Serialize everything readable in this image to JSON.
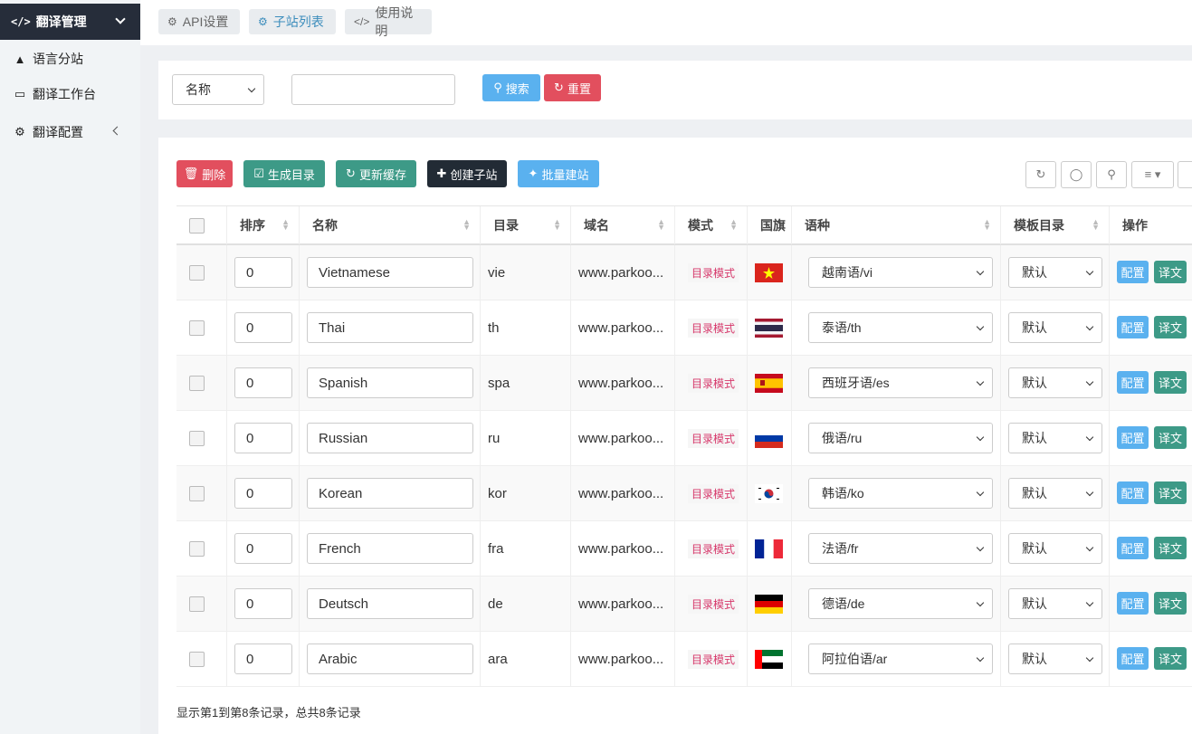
{
  "sidebar": {
    "header": "翻译管理",
    "items": [
      {
        "label": "语言分站"
      },
      {
        "label": "翻译工作台"
      },
      {
        "label": "翻译配置"
      }
    ]
  },
  "tabs": [
    {
      "label": "API设置"
    },
    {
      "label": "子站列表"
    },
    {
      "label": "使用说明"
    }
  ],
  "search": {
    "field_select": "名称",
    "keyword": "",
    "search_label": "搜索",
    "reset_label": "重置"
  },
  "toolbar": {
    "delete": "删除",
    "gen_dir": "生成目录",
    "refresh_cache": "更新缓存",
    "create_site": "创建子站",
    "batch_create": "批量建站"
  },
  "columns": [
    "排序",
    "名称",
    "目录",
    "域名",
    "模式",
    "国旗",
    "语种",
    "模板目录",
    "操作"
  ],
  "rows": [
    {
      "sort": "0",
      "name": "Vietnamese",
      "dir": "vie",
      "domain": "www.parkoo...",
      "mode": "目录模式",
      "flag": "vn",
      "lang": "越南语/vi",
      "tpl": "默认"
    },
    {
      "sort": "0",
      "name": "Thai",
      "dir": "th",
      "domain": "www.parkoo...",
      "mode": "目录模式",
      "flag": "th",
      "lang": "泰语/th",
      "tpl": "默认"
    },
    {
      "sort": "0",
      "name": "Spanish",
      "dir": "spa",
      "domain": "www.parkoo...",
      "mode": "目录模式",
      "flag": "es",
      "lang": "西班牙语/es",
      "tpl": "默认"
    },
    {
      "sort": "0",
      "name": "Russian",
      "dir": "ru",
      "domain": "www.parkoo...",
      "mode": "目录模式",
      "flag": "ru",
      "lang": "俄语/ru",
      "tpl": "默认"
    },
    {
      "sort": "0",
      "name": "Korean",
      "dir": "kor",
      "domain": "www.parkoo...",
      "mode": "目录模式",
      "flag": "kr",
      "lang": "韩语/ko",
      "tpl": "默认"
    },
    {
      "sort": "0",
      "name": "French",
      "dir": "fra",
      "domain": "www.parkoo...",
      "mode": "目录模式",
      "flag": "fr",
      "lang": "法语/fr",
      "tpl": "默认"
    },
    {
      "sort": "0",
      "name": "Deutsch",
      "dir": "de",
      "domain": "www.parkoo...",
      "mode": "目录模式",
      "flag": "de",
      "lang": "德语/de",
      "tpl": "默认"
    },
    {
      "sort": "0",
      "name": "Arabic",
      "dir": "ara",
      "domain": "www.parkoo...",
      "mode": "目录模式",
      "flag": "ae",
      "lang": "阿拉伯语/ar",
      "tpl": "默认"
    }
  ],
  "row_actions": {
    "config": "配置",
    "translate": "译文"
  },
  "footer": "显示第1到第8条记录，总共8条记录",
  "colors": {
    "sidebar_header": "#262d3a",
    "blue": "#5ab1ef",
    "red": "#e24f5e",
    "green": "#3d9a87",
    "dark": "#222b35",
    "mode_badge": "#d6376a"
  }
}
